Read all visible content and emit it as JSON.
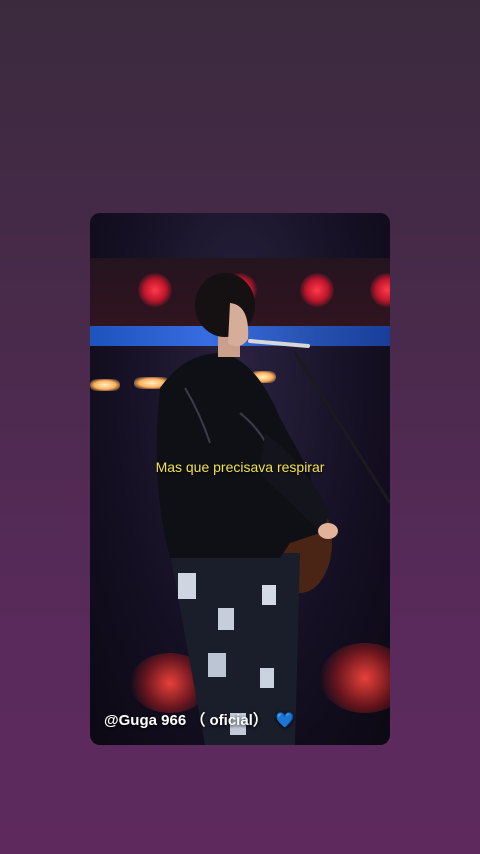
{
  "caption": "Mas que precisava respirar",
  "credit": "@Guga 966 （ oficial）",
  "heart_icon": "💙",
  "colors": {
    "caption": "#f2e14a",
    "credit": "#ffffff",
    "heart": "#3d9cff"
  }
}
